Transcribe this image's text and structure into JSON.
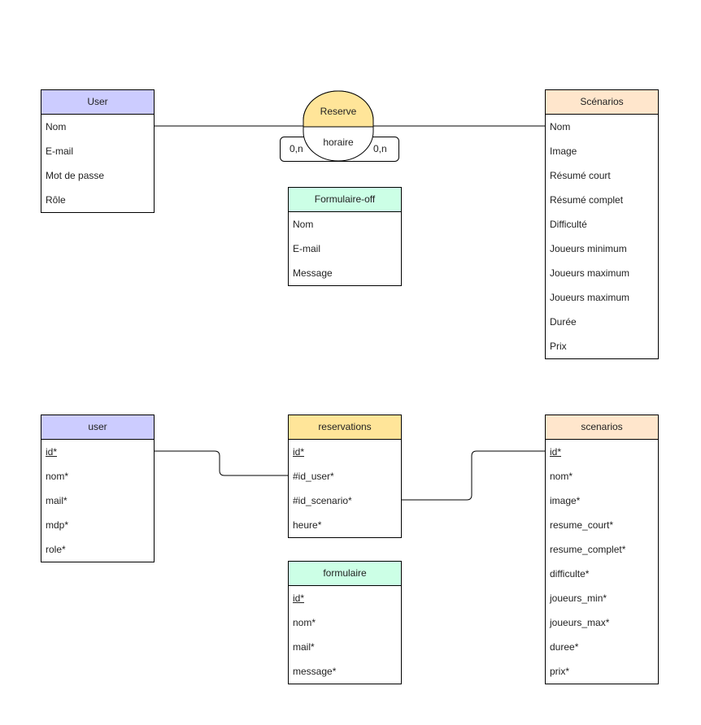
{
  "colors": {
    "user_header": "#CCCCFF",
    "scenario_header": "#FFE6CC",
    "reserve_fill": "#FFE599",
    "form_header": "#CCFFE6"
  },
  "conceptual": {
    "user": {
      "title": "User",
      "fields": [
        "Nom",
        "E-mail",
        "Mot de passe",
        "Rôle"
      ]
    },
    "scenarios": {
      "title": "Scénarios",
      "fields": [
        "Nom",
        "Image",
        "Résumé court",
        "Résumé complet",
        "Difficulté",
        "Joueurs minimum",
        "Joueurs maximum",
        "Joueurs maximum",
        "Durée",
        "Prix"
      ]
    },
    "formulaire": {
      "title": "Formulaire-off",
      "fields": [
        "Nom",
        "E-mail",
        "Message"
      ]
    },
    "reserve": {
      "title": "Reserve",
      "attribute": "horaire",
      "card_left": "0,n",
      "card_right": "0,n"
    }
  },
  "physical": {
    "user": {
      "title": "user",
      "fields": [
        "id*",
        "nom*",
        "mail*",
        "mdp*",
        "role*"
      ]
    },
    "reservations": {
      "title": "reservations",
      "fields": [
        "id*",
        "#id_user*",
        "#id_scenario*",
        "heure*"
      ]
    },
    "scenarios": {
      "title": "scenarios",
      "fields": [
        "id*",
        "nom*",
        "image*",
        "resume_court*",
        "resume_complet*",
        "difficulte*",
        "joueurs_min*",
        "joueurs_max*",
        "duree*",
        "prix*"
      ]
    },
    "formulaire": {
      "title": "formulaire",
      "fields": [
        "id*",
        "nom*",
        "mail*",
        "message*"
      ]
    }
  }
}
